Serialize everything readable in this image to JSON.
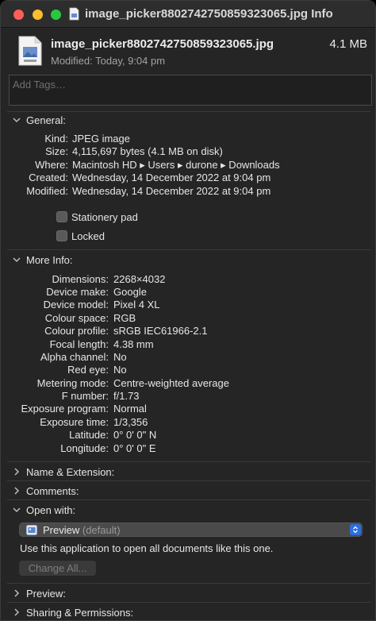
{
  "window": {
    "title": "image_picker8802742750859323065.jpg Info"
  },
  "header": {
    "file_name": "image_picker8802742750859323065.jpg",
    "size": "4.1 MB",
    "modified_label": "Modified:",
    "modified_value": "Today, 9:04 pm"
  },
  "tags": {
    "placeholder": "Add Tags…"
  },
  "general": {
    "title": "General:",
    "rows": [
      {
        "key": "Kind:",
        "value": "JPEG image"
      },
      {
        "key": "Size:",
        "value": "4,115,697 bytes (4.1 MB on disk)"
      },
      {
        "key": "Where:",
        "value": "Macintosh HD ▸ Users ▸ durone ▸ Downloads"
      },
      {
        "key": "Created:",
        "value": "Wednesday, 14 December 2022 at 9:04 pm"
      },
      {
        "key": "Modified:",
        "value": "Wednesday, 14 December 2022 at 9:04 pm"
      }
    ],
    "stationery_label": "Stationery pad",
    "locked_label": "Locked"
  },
  "more_info": {
    "title": "More Info:",
    "rows": [
      {
        "key": "Dimensions:",
        "value": "2268×4032"
      },
      {
        "key": "Device make:",
        "value": "Google"
      },
      {
        "key": "Device model:",
        "value": "Pixel 4 XL"
      },
      {
        "key": "Colour space:",
        "value": "RGB"
      },
      {
        "key": "Colour profile:",
        "value": "sRGB IEC61966-2.1"
      },
      {
        "key": "Focal length:",
        "value": "4.38 mm"
      },
      {
        "key": "Alpha channel:",
        "value": "No"
      },
      {
        "key": "Red eye:",
        "value": "No"
      },
      {
        "key": "Metering mode:",
        "value": "Centre-weighted average"
      },
      {
        "key": "F number:",
        "value": "f/1.73"
      },
      {
        "key": "Exposure program:",
        "value": "Normal"
      },
      {
        "key": "Exposure time:",
        "value": "1/3,356"
      },
      {
        "key": "Latitude:",
        "value": "0° 0' 0\" N"
      },
      {
        "key": "Longitude:",
        "value": "0° 0' 0\" E"
      }
    ]
  },
  "sections": {
    "name_extension": "Name & Extension:",
    "comments": "Comments:",
    "open_with": "Open with:",
    "preview": "Preview:",
    "sharing": "Sharing & Permissions:"
  },
  "open_with": {
    "app_name": "Preview",
    "app_suffix": "(default)",
    "hint": "Use this application to open all documents like this one.",
    "change_all_label": "Change All..."
  },
  "colors": {
    "window_bg": "#252525",
    "accent": "#2b6fe0",
    "close": "#ff5f57",
    "minimize": "#febc2e",
    "zoom": "#28c840"
  }
}
